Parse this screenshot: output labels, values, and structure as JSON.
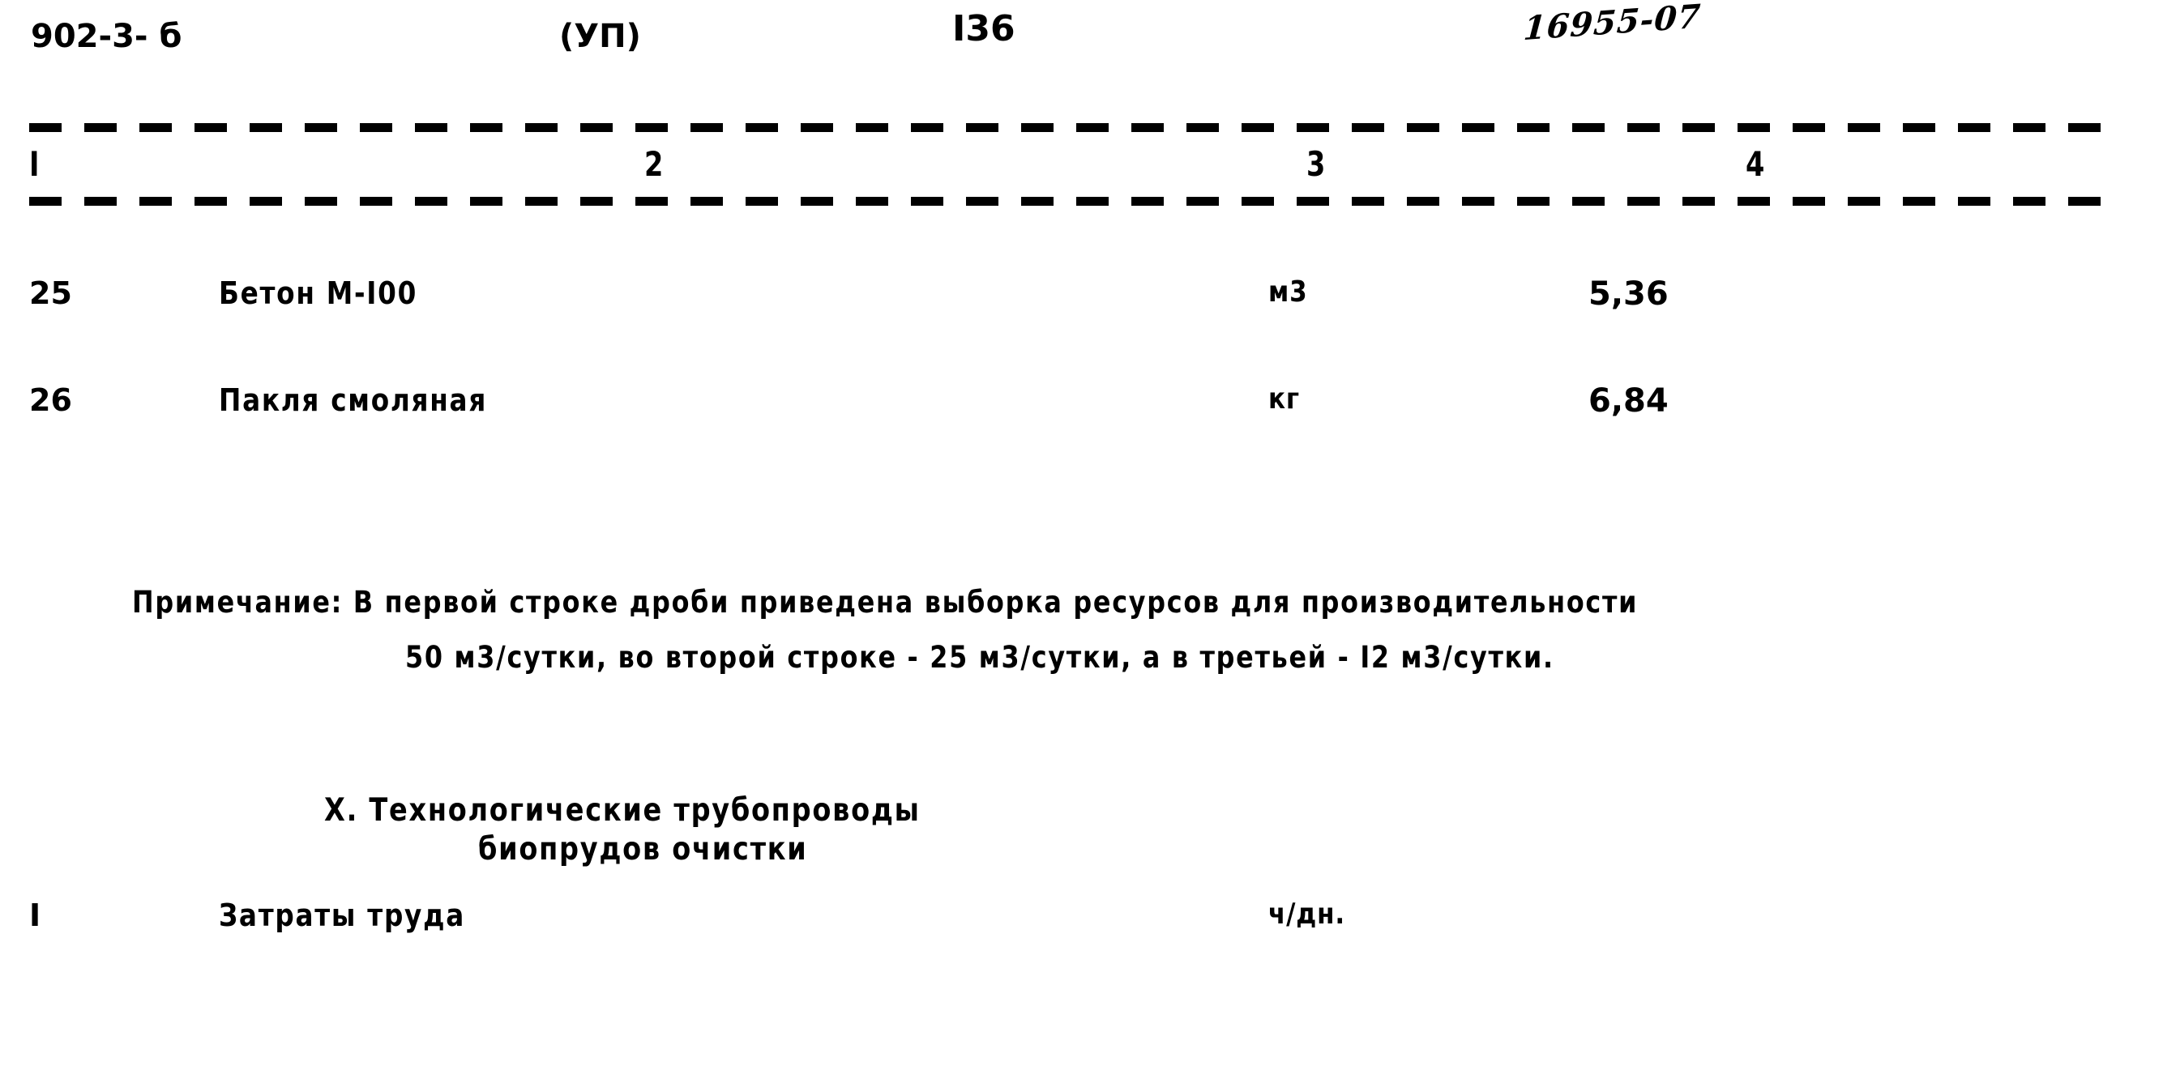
{
  "header": {
    "doc_code": "902-3- б",
    "series": "(УП)",
    "page_number": "I36",
    "handwritten_stamp": "16955-07"
  },
  "table": {
    "column_numbers": [
      "I",
      "2",
      "3",
      "4"
    ],
    "rows": [
      {
        "no": "25",
        "name": "Бетон М-I00",
        "unit": "м3",
        "value": "5,36"
      },
      {
        "no": "26",
        "name": "Пакля смоляная",
        "unit": "кг",
        "value": "6,84"
      }
    ]
  },
  "note": {
    "line_1": "Примечание: В первой строке дроби приведена выборка ресурсов для производительности",
    "line_2": "50 м3/сутки, во второй строке - 25 м3/сутки, а в третьей - I2 м3/сутки."
  },
  "section_heading": {
    "line_1": "X. Технологические трубопроводы",
    "line_2": "биопрудов очистки"
  },
  "final_row": {
    "no": "I",
    "name": "Затраты труда",
    "unit": "ч/дн.",
    "value": ""
  },
  "colors": {
    "ink": "#000000",
    "paper": "#ffffff"
  }
}
